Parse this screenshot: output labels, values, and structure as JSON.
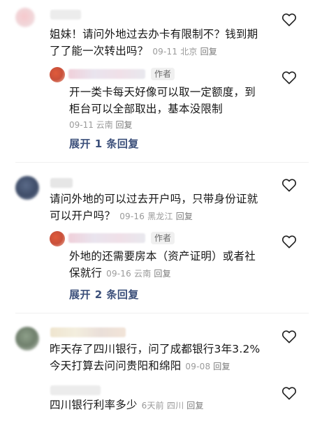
{
  "comments": [
    {
      "text_lines": [
        "姐妹！请问外地过去办卡有限制不？钱到期",
        "了了能一次转出吗？"
      ],
      "date": "09-11",
      "location": "北京",
      "reply_label": "回复",
      "reply": {
        "author_tag": "作者",
        "text_lines": [
          "开一类卡每天好像可以取一定额度，到",
          "柜台可以全部取出，基本没限制"
        ],
        "date": "09-11",
        "location": "云南",
        "reply_label": "回复"
      },
      "expand_label": "展开 1 条回复"
    },
    {
      "text_lines": [
        "请问外地的可以过去开户吗，只带身份证就",
        "可以开户吗？"
      ],
      "date": "09-16",
      "location": "黑龙江",
      "reply_label": "回复",
      "reply": {
        "author_tag": "作者",
        "text_lines": [
          "外地的还需要房本（资产证明）或者社",
          "保就行"
        ],
        "date": "09-16",
        "location": "云南",
        "reply_label": "回复"
      },
      "expand_label": "展开 2 条回复"
    },
    {
      "text_lines": [
        "昨天存了四川银行，问了成都银行3年3.2%",
        "今天打算去问问贵阳和绵阳"
      ],
      "date": "09-08",
      "location": "",
      "reply_label": "回复",
      "reply": {
        "text_lines": [
          "四川银行利率多少"
        ],
        "date": "6天前",
        "location": "四川",
        "reply_label": "回复"
      }
    }
  ],
  "icons": {
    "like": "heart-outline-icon"
  },
  "colors": {
    "expand_link": "#3b4f7a",
    "meta": "#9a9a9a",
    "author_tag_bg": "#f0f0f0"
  }
}
